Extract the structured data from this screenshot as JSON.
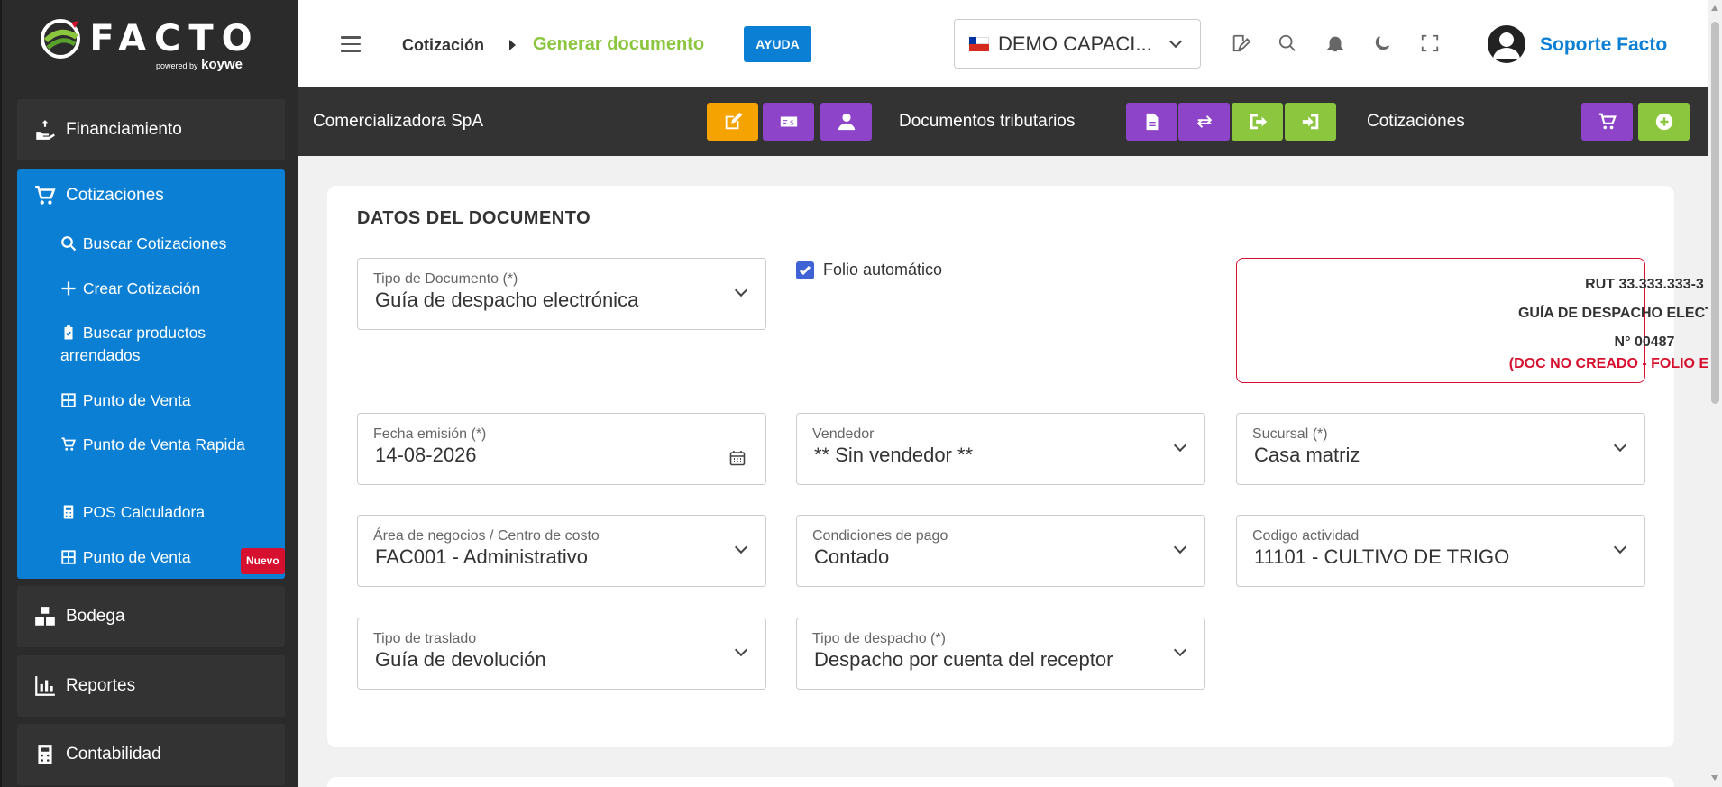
{
  "brand": {
    "logo_text": "FACTO",
    "powered": "powered by",
    "partner": "koywe"
  },
  "sidebar": {
    "financiamiento": "Financiamiento",
    "cotizaciones": "Cotizaciones",
    "sub_items": [
      {
        "label": "Buscar Cotizaciones",
        "icon": "search-icon"
      },
      {
        "label": "Crear Cotización",
        "icon": "plus-icon"
      },
      {
        "label": "Buscar productos arrendados",
        "icon": "clipboard-check-icon"
      },
      {
        "label": "Punto de Venta",
        "icon": "grid-icon"
      },
      {
        "label": "Punto de Venta Rapida",
        "icon": "cart-plus-icon"
      },
      {
        "label": "POS Calculadora",
        "icon": "calculator-icon"
      },
      {
        "label": "Punto de Venta",
        "icon": "grid-icon",
        "badge": "Nuevo"
      }
    ],
    "bodega": "Bodega",
    "reportes": "Reportes",
    "contabilidad": "Contabilidad"
  },
  "header": {
    "breadcrumb_parent": "Cotización",
    "breadcrumb_current": "Generar documento",
    "help_label": "AYUDA",
    "company": "DEMO CAPACI...",
    "user_name": "Soporte Facto"
  },
  "actionbar": {
    "company_name": "Comercializadora SpA",
    "tax_docs_label": "Documentos tributarios",
    "quotes_label": "Cotizaciónes"
  },
  "document": {
    "section_title": "DATOS DEL DOCUMENTO",
    "tipo_documento": {
      "label": "Tipo de Documento (*)",
      "value": "Guía de despacho electrónica"
    },
    "folio_automatico": {
      "label": "Folio automático",
      "checked": true
    },
    "rut_box": {
      "rut": "RUT 33.333.333-3",
      "doc_type": "GUÍA DE DESPACHO ELECTRÓNICA",
      "number": "N° 00487",
      "status": "(DOC NO CREADO - FOLIO ESTIMADO)"
    },
    "fecha_emision": {
      "label": "Fecha emisión (*)",
      "value": "14-08-2026"
    },
    "vendedor": {
      "label": "Vendedor",
      "value": "** Sin vendedor **"
    },
    "sucursal": {
      "label": "Sucursal (*)",
      "value": "Casa matriz"
    },
    "area_negocios": {
      "label": "Área de negocios / Centro de costo",
      "value": "FAC001 - Administrativo"
    },
    "condiciones_pago": {
      "label": "Condiciones de pago",
      "value": "Contado"
    },
    "codigo_actividad": {
      "label": "Codigo actividad",
      "value": "11101 - CULTIVO DE TRIGO"
    },
    "tipo_traslado": {
      "label": "Tipo de traslado",
      "value": "Guía de devolución"
    },
    "tipo_despacho": {
      "label": "Tipo de despacho (*)",
      "value": "Despacho por cuenta del receptor"
    }
  },
  "colors": {
    "primary_blue": "#0a7fd4",
    "brand_green": "#8cc63f",
    "orange": "#f5a300",
    "purple": "#8e44c9",
    "alert_red": "#d6102f"
  }
}
